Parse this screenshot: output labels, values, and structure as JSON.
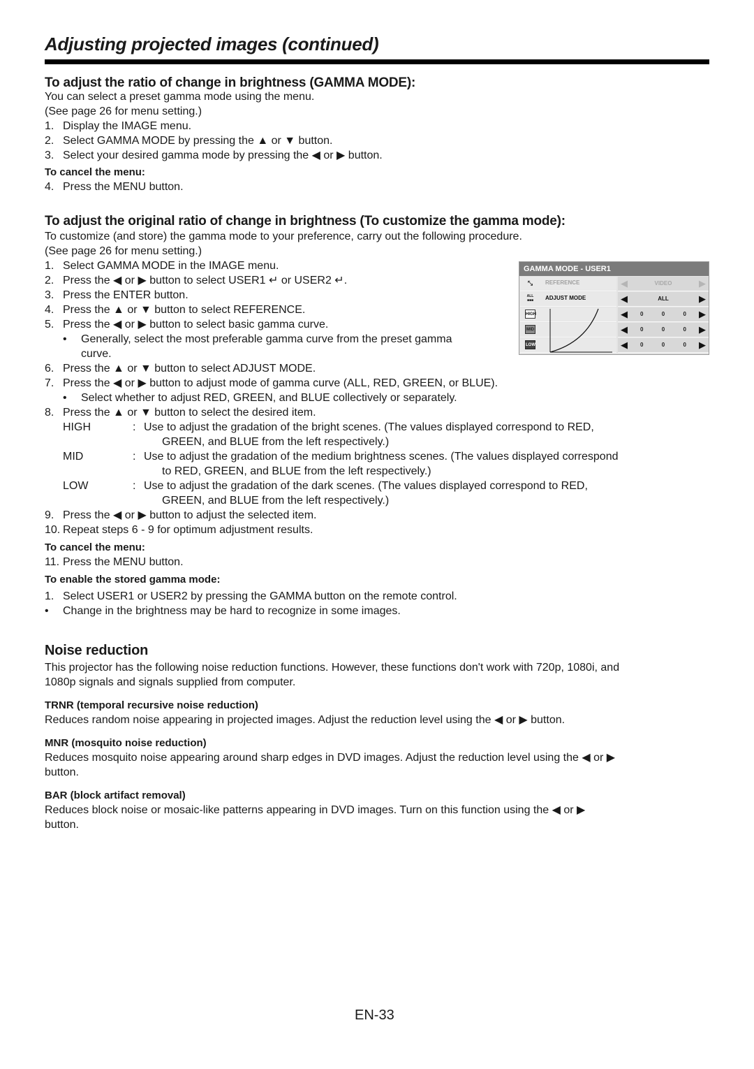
{
  "page": {
    "title": "Adjusting projected images (continued)",
    "page_number": "EN-33"
  },
  "gamma_mode": {
    "heading": "To adjust the ratio of change in brightness (GAMMA MODE):",
    "intro": "You can select a preset gamma mode using the menu.",
    "see_page": "(See page 26 for menu setting.)",
    "steps": [
      {
        "num": "1.",
        "text": "Display the IMAGE menu."
      },
      {
        "num": "2.",
        "text": "Select GAMMA MODE by pressing the ▲ or ▼ button."
      },
      {
        "num": "3.",
        "text": "Select your desired gamma mode by pressing the ◀ or ▶ button."
      }
    ],
    "cancel_heading": "To cancel the menu:",
    "cancel_step": {
      "num": "4.",
      "text": "Press the MENU button."
    }
  },
  "customize": {
    "heading": "To adjust the original ratio of change in brightness (To customize the gamma mode):",
    "intro": "To customize (and store) the gamma mode to your preference, carry out the following procedure.",
    "see_page": "(See page 26 for menu setting.)",
    "steps": [
      {
        "num": "1.",
        "text": "Select GAMMA MODE in the IMAGE menu."
      },
      {
        "num": "2.",
        "text": "Press the ◀ or ▶ button to select USER1 ↵ or USER2 ↵."
      },
      {
        "num": "3.",
        "text": "Press the ENTER button."
      },
      {
        "num": "4.",
        "text": "Press the ▲ or ▼ button to select REFERENCE."
      },
      {
        "num": "5.",
        "text": "Press the ◀ or ▶ button to select basic gamma curve."
      }
    ],
    "bullet5_line1": "Generally, select the most preferable gamma curve from the preset gamma",
    "bullet5_line2": "curve.",
    "steps2": [
      {
        "num": "6.",
        "text": "Press the ▲ or ▼ button to select ADJUST MODE."
      },
      {
        "num": "7.",
        "text": "Press the ◀ or ▶ button to adjust mode of gamma curve (ALL, RED, GREEN, or BLUE)."
      }
    ],
    "bullet7": "Select whether to adjust RED, GREEN, and BLUE collectively or separately.",
    "step8": {
      "num": "8.",
      "text": "Press the ▲ or ▼ button to select the desired item."
    },
    "terms": [
      {
        "term": "HIGH",
        "line1": "Use to adjust the gradation of the bright scenes. (The values displayed correspond to RED,",
        "line2": "GREEN, and BLUE from the left respectively.)"
      },
      {
        "term": "MID",
        "line1": "Use to adjust the gradation of the medium brightness scenes. (The values displayed correspond",
        "line2": "to RED, GREEN, and BLUE from the left respectively.)"
      },
      {
        "term": "LOW",
        "line1": "Use to adjust the gradation of the dark scenes. (The values displayed correspond to RED,",
        "line2": "GREEN, and BLUE from the left respectively.)"
      }
    ],
    "step9": {
      "num": "9.",
      "text": "Press the ◀ or ▶ button to adjust the selected item."
    },
    "step10": {
      "num": "10.",
      "text": "Repeat steps 6 - 9 for optimum adjustment results."
    },
    "cancel_heading": "To cancel the menu:",
    "cancel_step": {
      "num": "11.",
      "text": "Press the MENU button."
    },
    "enable_heading": "To enable the stored gamma mode:",
    "enable_step": {
      "num": "1.",
      "text": "Select USER1 or USER2 by pressing the GAMMA button on the remote control."
    },
    "enable_bullet": "Change in the brightness may be hard to recognize in some images."
  },
  "osd": {
    "title": "GAMMA MODE - USER1",
    "rows": [
      {
        "icon": "reference-icon",
        "label": "REFERENCE",
        "value": "VIDEO"
      },
      {
        "icon": "adjust-mode-icon",
        "icon_text": "ALL",
        "label": "ADJUST MODE",
        "value": "ALL"
      },
      {
        "icon": "high-icon",
        "icon_text": "HIGH",
        "values": [
          "0",
          "0",
          "0"
        ]
      },
      {
        "icon": "mid-icon",
        "icon_text": "MID",
        "values": [
          "0",
          "0",
          "0"
        ]
      },
      {
        "icon": "low-icon",
        "icon_text": "LOW",
        "values": [
          "0",
          "0",
          "0"
        ]
      }
    ],
    "arrow_left": "◀",
    "arrow_right": "▶"
  },
  "noise": {
    "heading": "Noise reduction",
    "intro_line1": "This projector has the following noise reduction functions. However, these functions don't work with 720p, 1080i, and",
    "intro_line2": "1080p signals and signals supplied from computer.",
    "items": [
      {
        "title": "TRNR (temporal recursive noise reduction)",
        "line1": "Reduces random noise appearing in projected images. Adjust the reduction level using the ◀ or ▶ button.",
        "line2": ""
      },
      {
        "title": "MNR (mosquito noise reduction)",
        "line1": "Reduces mosquito noise appearing around sharp edges in DVD images. Adjust the reduction level using the ◀ or ▶",
        "line2": "button."
      },
      {
        "title": "BAR (block artifact removal)",
        "line1": "Reduces block noise or mosaic-like patterns appearing in DVD images. Turn on this function using the ◀ or ▶",
        "line2": "button."
      }
    ]
  }
}
